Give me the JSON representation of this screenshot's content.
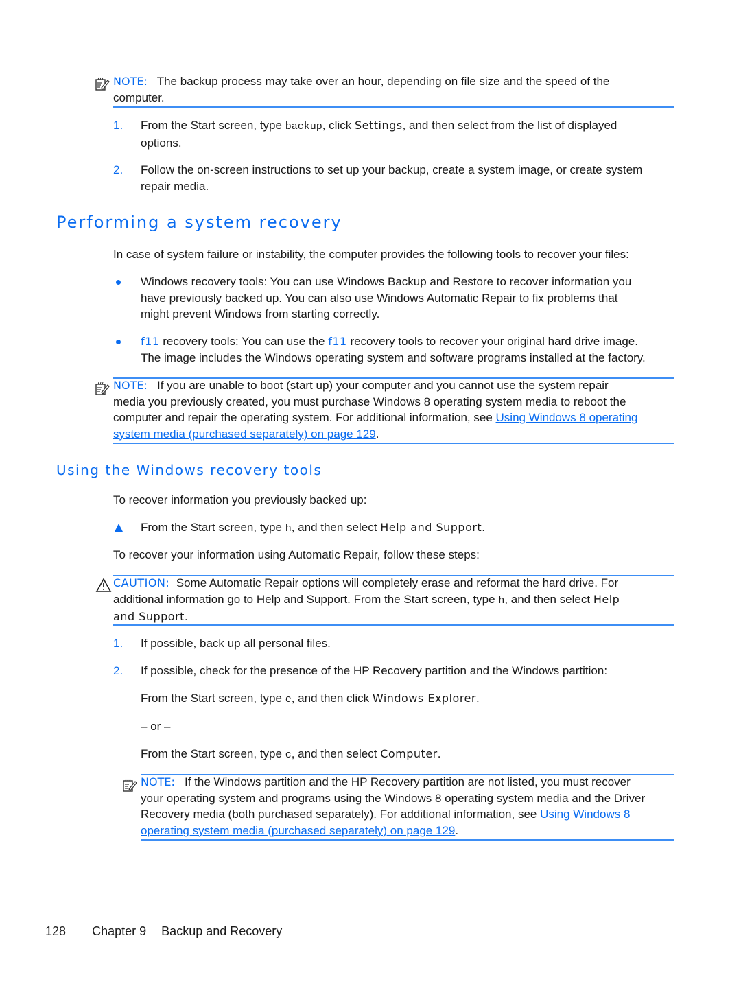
{
  "note1": {
    "label": "NOTE:",
    "text": "The backup process may take over an hour, depending on file size and the speed of the",
    "text2": "computer."
  },
  "steps1": [
    {
      "num": "1.",
      "pre": "From the Start screen, type ",
      "code": "backup",
      "mid": ", click ",
      "ui": "Settings",
      "post": ", and then select from the list of displayed",
      "line2": "options."
    },
    {
      "num": "2.",
      "text": "Follow the on-screen instructions to set up your backup, create a system image, or create system",
      "line2": "repair media."
    }
  ],
  "section1": {
    "title": "Performing a system recovery",
    "intro": "In case of system failure or instability, the computer provides the following tools to recover your files:",
    "bullets": [
      {
        "lines": [
          "Windows recovery tools: You can use Windows Backup and Restore to recover information you",
          "have previously backed up. You can also use Windows Automatic Repair to fix problems that",
          "might prevent Windows from starting correctly."
        ]
      },
      {
        "key": "f11",
        "mid": " recovery tools: You can use the ",
        "key2": "f11",
        "post": " recovery tools to recover your original hard drive image.",
        "line2": "The image includes the Windows operating system and software programs installed at the factory."
      }
    ]
  },
  "note2": {
    "label": "NOTE:",
    "line1": "If you are unable to boot (start up) your computer and you cannot use the system repair",
    "line2": "media you previously created, you must purchase Windows 8 operating system media to reboot the",
    "line3_pre": "computer and repair the operating system. For additional information, see ",
    "link_part1": "Using Windows 8 operating",
    "link_part2": "system media (purchased separately) on page 129",
    "end": "."
  },
  "section2": {
    "title": "Using the Windows recovery tools",
    "intro": "To recover information you previously backed up:",
    "step": {
      "pre": "From the Start screen, type ",
      "code": "h",
      "mid": ", and then select ",
      "ui": "Help and Support",
      "post": "."
    },
    "intro2": "To recover your information using Automatic Repair, follow these steps:"
  },
  "caution": {
    "label": "CAUTION:",
    "line1": "Some Automatic Repair options will completely erase and reformat the hard drive. For",
    "line2_pre": "additional information go to Help and Support. From the Start screen, type ",
    "code": "h",
    "line2_mid": ", and then select ",
    "ui_a": "Help",
    "ui_b": "and Support",
    "end": "."
  },
  "steps2": [
    {
      "num": "1.",
      "text": "If possible, back up all personal files."
    },
    {
      "num": "2.",
      "text": "If possible, check for the presence of the HP Recovery partition and the Windows partition:"
    }
  ],
  "sub": {
    "a_pre": "From the Start screen, type ",
    "a_code": "e",
    "a_mid": ", and then click ",
    "a_ui": "Windows Explorer",
    "a_post": ".",
    "or": "– or –",
    "b_pre": "From the Start screen, type ",
    "b_code": "c",
    "b_mid": ", and then select ",
    "b_ui": "Computer",
    "b_post": "."
  },
  "note3": {
    "label": "NOTE:",
    "line1": "If the Windows partition and the HP Recovery partition are not listed, you must recover",
    "line2": "your operating system and programs using the Windows 8 operating system media and the Driver",
    "line3_pre": "Recovery media (both purchased separately). For additional information, see ",
    "link_part1": "Using Windows 8",
    "link_part2": "operating system media (purchased separately) on page 129",
    "end": "."
  },
  "footer": {
    "page": "128",
    "chapter": "Chapter 9",
    "title": "Backup and Recovery"
  }
}
